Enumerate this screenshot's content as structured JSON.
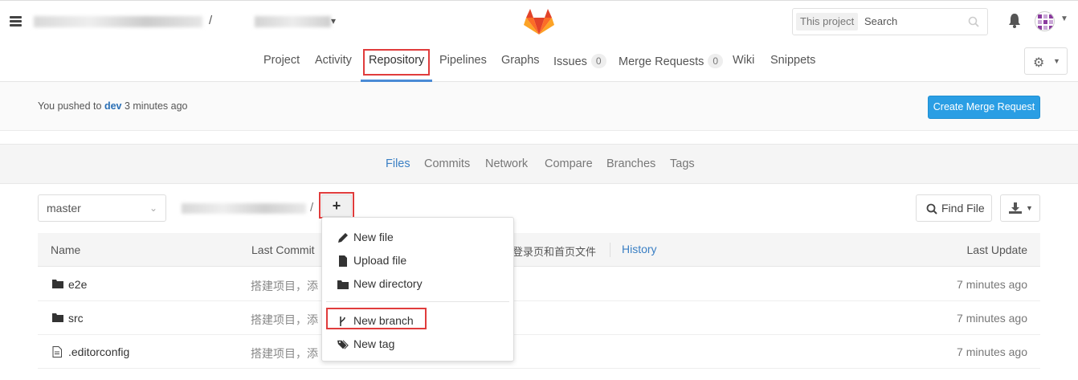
{
  "header": {
    "path_separator": "/",
    "search_scope": "This project",
    "search_placeholder": "Search"
  },
  "project_nav": {
    "items": [
      "Project",
      "Activity",
      "Repository",
      "Pipelines",
      "Graphs",
      "Issues",
      "Merge Requests",
      "Wiki",
      "Snippets"
    ],
    "active": "Repository",
    "issues_count": "0",
    "mr_count": "0"
  },
  "push_alert": {
    "prefix": "You pushed to ",
    "branch": "dev",
    "suffix": " 3 minutes ago",
    "button": "Create Merge Request"
  },
  "repo_nav": {
    "items": [
      "Files",
      "Commits",
      "Network",
      "Compare",
      "Branches",
      "Tags"
    ],
    "active": "Files"
  },
  "toolbar": {
    "branch": "master",
    "crumb_sep": "/",
    "plus": "+",
    "find_file": "Find File"
  },
  "table": {
    "col_name": "Name",
    "col_commit": "Last Commit",
    "col_update": "Last Update",
    "head_commit_msg": "加登录页和首页文件",
    "history": "History",
    "rows": [
      {
        "name": "e2e",
        "type": "folder",
        "msg": "搭建项目，添",
        "time": "7 minutes ago"
      },
      {
        "name": "src",
        "type": "folder",
        "msg": "搭建项目，添",
        "time": "7 minutes ago"
      },
      {
        "name": ".editorconfig",
        "type": "file",
        "msg": "搭建项目，添",
        "time": "7 minutes ago"
      }
    ]
  },
  "dropdown": {
    "items": [
      "New file",
      "Upload file",
      "New directory",
      "New branch",
      "New tag"
    ]
  },
  "colors": {
    "accent": "#4a8bd6",
    "primary_button": "#2a9ee4",
    "highlight_box": "#e03c3c"
  }
}
